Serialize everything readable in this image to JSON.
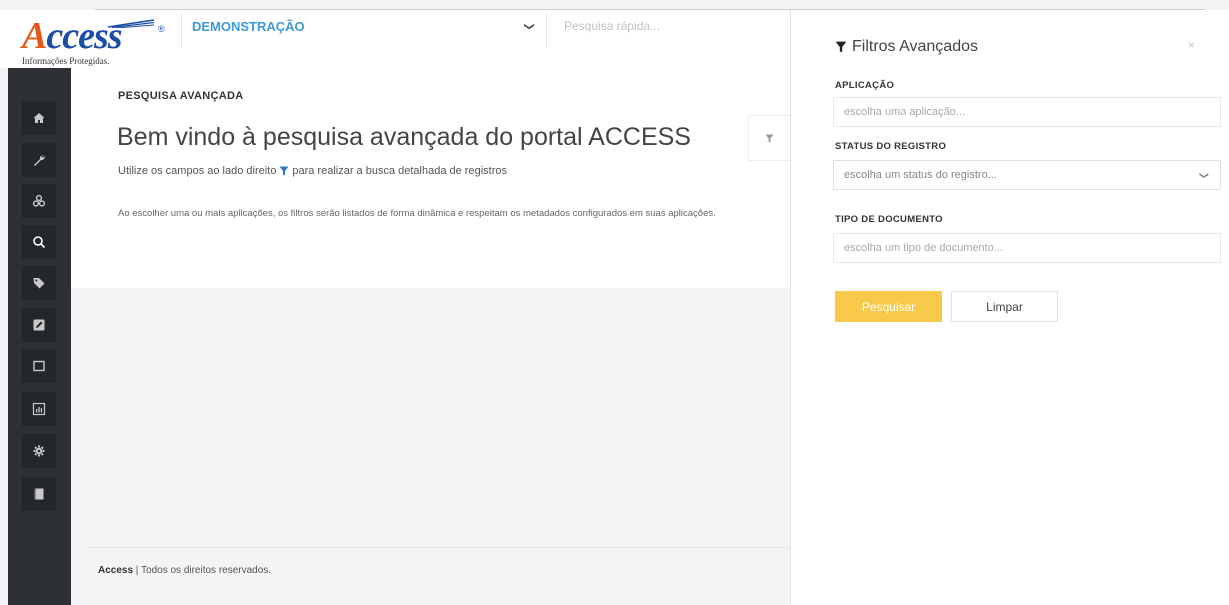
{
  "header": {
    "logo": {
      "wordmark": "Access",
      "registered": "®",
      "tagline": "Informações Protegidas."
    },
    "app_selector": {
      "value": "DEMONSTRAÇÃO",
      "icon": "chevron-down-icon"
    },
    "quick_search": {
      "placeholder": "Pesquisa rápida..."
    }
  },
  "sidebar": {
    "items": [
      {
        "icon": "home-icon"
      },
      {
        "icon": "wrench-icon"
      },
      {
        "icon": "cubes-icon"
      },
      {
        "icon": "search-icon"
      },
      {
        "icon": "tag-icon"
      },
      {
        "icon": "edit-icon"
      },
      {
        "icon": "window-icon"
      },
      {
        "icon": "chart-icon"
      },
      {
        "icon": "gear-icon"
      },
      {
        "icon": "book-icon"
      }
    ]
  },
  "main": {
    "section_label": "PESQUISA AVANÇADA",
    "welcome_title": "Bem vindo à pesquisa avançada do portal ACCESS",
    "subtext_before": "Utilize os campos ao lado direito",
    "subtext_after": "para realizar a busca detalhada de registros",
    "description": "Ao escolher uma ou mais aplicações, os filtros serão listados de forma dinâmica e respeitam os metadados configurados em suas aplicações."
  },
  "footer": {
    "brand": "Access",
    "separator": " | ",
    "rights": "Todos os direitos reservados."
  },
  "filters_panel": {
    "title": "Filtros Avançados",
    "close_symbol": "×",
    "application": {
      "label": "APLICAÇÃO",
      "placeholder": "escolha uma aplicação..."
    },
    "status": {
      "label": "STATUS DO REGISTRO",
      "placeholder": "escolha um status do registro..."
    },
    "document_type": {
      "label": "TIPO DE DOCUMENTO",
      "placeholder": "escolha um tipo de documento..."
    },
    "search_button": "Pesquisar",
    "clear_button": "Limpar"
  },
  "colors": {
    "brand_blue": "#1d4ea5",
    "brand_orange": "#e25a1b",
    "accent_blue": "#3d9ad6",
    "sidebar_bg": "#2d3136",
    "search_button": "#f8c94b"
  }
}
